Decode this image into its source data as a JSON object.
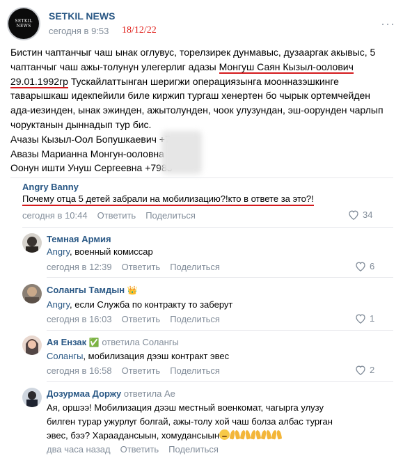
{
  "post": {
    "group_logo_line1": "SETKIL",
    "group_logo_line2": "NEWS",
    "group_name": "SETKIL NEWS",
    "time": "сегодня в 9:53",
    "date_note": "18/12/22",
    "more_label": "···",
    "lines": [
      {
        "a": "Бистин чаптанчыг чаш ынак оглувус, торелзирек дунмавыс, дузааргак акывыс, 5"
      },
      {
        "a": "чаптанчыг чаш ажы-толунун улегерлиг адазы ",
        "u": "Монгуш Саян Кызыл-оолович"
      },
      {
        "u": "29.01.1992гр",
        "a": " Тускайлаттынган шеригжи операциязынга моонназэшкинге"
      },
      {
        "a": "таварышкаш идекпейили биле киржип тургаш хенертен бо чырык ортемчейден"
      },
      {
        "a": "ада-иезинден, ынак эжинден, ажытолунден, чоок улузундан, эш-оорунден чарлып"
      },
      {
        "a": "чоруктанын дыннадып тур бис."
      },
      {
        "a": "Ачазы Кызыл-Оол Бопушкаевич +7"
      },
      {
        "a": "Авазы Марианна Монгун-ооловна"
      },
      {
        "a": "Оонун ишти Унуш Сергеевна +7983"
      }
    ]
  },
  "comments": [
    {
      "author": "Angry Banny",
      "text": "Почему отца 5 детей забрали на мобилизацию?!кто в ответе за это?!",
      "time": "сегодня в 10:44",
      "reply": "Ответить",
      "share": "Поделиться",
      "likes": "34"
    },
    {
      "author": "Темная Армия",
      "addressee": "Angry",
      "text": ", военный комиссар",
      "time": "сегодня в 12:39",
      "reply": "Ответить",
      "share": "Поделиться",
      "likes": "6"
    },
    {
      "author": "Солангы Тамдын",
      "author_badge": "👑",
      "addressee": "Angry",
      "text": ", если Служба по контракту то заберут",
      "time": "сегодня в 16:03",
      "reply": "Ответить",
      "share": "Поделиться",
      "likes": "1"
    },
    {
      "author": "Ая Ензак",
      "author_badge": "✅",
      "reply_note": "ответила Солангы",
      "addressee": "Солангы",
      "text": ", мобилизация дээш контракт эвес",
      "time": "сегодня в 16:58",
      "reply": "Ответить",
      "share": "Поделиться",
      "likes": "2"
    },
    {
      "author": "Дозурмаа Доржу",
      "reply_note": "ответила Ае",
      "text_line1": "Ая, оршээ! Мобилизация дээш местный военкомат, чагырга улузу",
      "text_line2": "билген турар ужурлуг болгай, ажы-толу хой чаш болза албас турган",
      "text_line3": "эвес, бээ? Хараадансыын, хомудансыын",
      "time": "два часа назад",
      "reply": "Ответить",
      "share": "Поделиться"
    }
  ],
  "colors": {
    "link": "#2a5885",
    "meta": "#818c99",
    "annotation_red": "#d4191c"
  }
}
